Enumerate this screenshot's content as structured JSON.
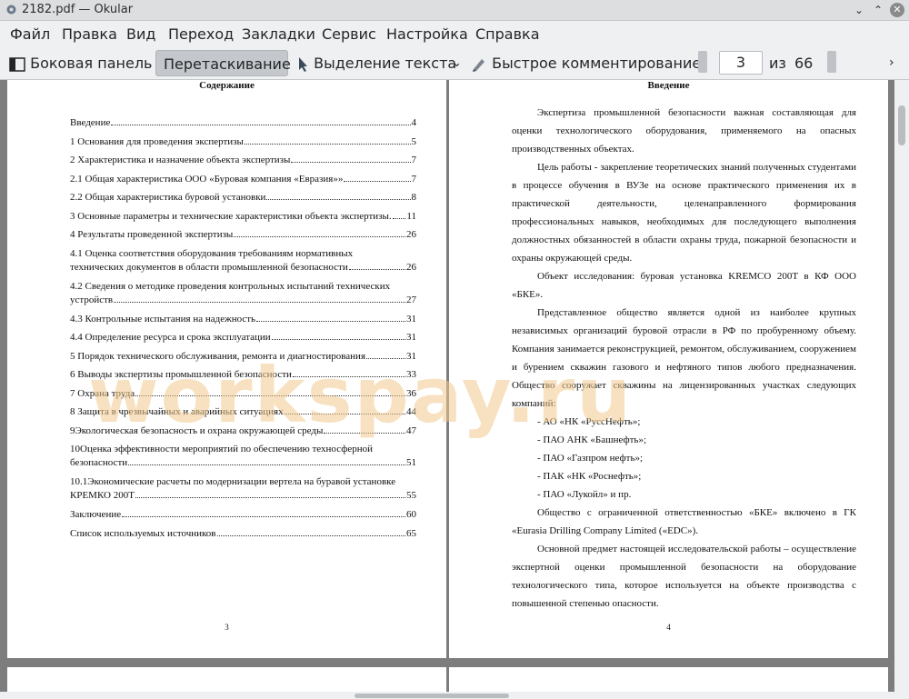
{
  "window": {
    "title": "2182.pdf  — Okular"
  },
  "menu": [
    "Файл",
    "Правка",
    "Вид",
    "Переход",
    "Закладки",
    "Сервис",
    "Настройка",
    "Справка"
  ],
  "toolbar": {
    "sidebar": "Боковая панель",
    "drag": "Перетаскивание",
    "text_select": "Выделение текста",
    "quick_annotate": "Быстрое комментирование",
    "current_page": "3",
    "of_label": "из",
    "total_pages": "66"
  },
  "page_left": {
    "heading": "Содержание",
    "toc": [
      {
        "label": "Введение",
        "page": "4"
      },
      {
        "label": "1 Основания для проведения экспертизы",
        "page": "5"
      },
      {
        "label": "2 Характеристика и назначение объекта экспертизы",
        "page": "7"
      },
      {
        "label": "2.1 Общая характеристика ООО «Буровая компания «Евразия»»",
        "page": "7"
      },
      {
        "label": "2.2 Общая характеристика буровой установки",
        "page": "8"
      },
      {
        "label": "3 Основные параметры и технические характеристики объекта экспертизы.",
        "page": "11"
      },
      {
        "label": "4 Результаты проведенной экспертизы",
        "page": "26"
      },
      {
        "label": "4.1 Оценка соответствия оборудования требованиям нормативных",
        "label2": "технических документов в области промышленной безопасности",
        "page": "26"
      },
      {
        "label": "4.2 Сведения о методике проведения контрольных испытаний технических",
        "label2": "устройств",
        "page": "27"
      },
      {
        "label": "4.3 Контрольные испытания на надежность",
        "page": "31"
      },
      {
        "label": "4.4 Определение ресурса и срока эксплуатации",
        "page": "31"
      },
      {
        "label": "5 Порядок технического обслуживания, ремонта и диагностирования",
        "page": "31"
      },
      {
        "label": "6 Выводы экспертизы промышленной безопасности",
        "page": "33"
      },
      {
        "label": "7 Охрана труда",
        "page": "36"
      },
      {
        "label": "8 Защита в чрезвычайных и аварийных ситуациях",
        "page": "44"
      },
      {
        "label": "9Экологическая безопасность и охрана окружающей среды",
        "page": "47"
      },
      {
        "label": "10Оценка эффективности мероприятий по обеспечению техносферной",
        "label2": "безопасности",
        "page": "51"
      },
      {
        "label": "10.1Экономические расчеты по модернизации вертела на буравой установке",
        "label2": "КРЕМКО 200Т",
        "page": "55"
      },
      {
        "label": "Заключение",
        "page": "60"
      },
      {
        "label": "Список используемых источников",
        "page": "65"
      }
    ],
    "page_number": "3"
  },
  "page_right": {
    "heading": "Введение",
    "paragraphs": [
      "Экспертиза промышленной безопасности важная составляющая для оценки технологического оборудования, применяемого на опасных производственных объектах.",
      "Цель работы - закрепление теоретических знаний полученных студентами в процессе обучения в ВУЗе на основе практического применения их в практической деятельности, целенаправленного формирования профессиональных навыков, необходимых для последующего выполнения должностных обязанностей в области охраны труда, пожарной безопасности и охраны окружающей среды.",
      "Объект исследования: буровая установка KREMCO 200T в КФ ООО «БКЕ».",
      "Представленное общество является одной из наиболее крупных независимых организаций буровой отрасли в РФ по пробуренному объему. Компания занимается реконструкцией, ремонтом, обслуживанием, сооружением и бурением скважин газового и нефтяного типов любого предназначения. Общество сооружает скважины на лицензированных участках следующих компаний:",
      "- АО «НК «РуссНефть»;",
      "- ПАО АНК «Башнефть»;",
      "- ПАО «Газпром нефть»;",
      "- ПАК «НК «Роснефть»;",
      "- ПАО «Лукойл» и пр.",
      "Общество с ограниченной ответственностью «БКЕ» включено в ГК «Eurasia Drilling Company Limited («EDC»).",
      "Основной предмет настоящей исследовательской работы – осуществление экспертной оценки промышленной безопасности на оборудование технологического типа, которое используется на объекте производства с повышенной степенью опасности."
    ],
    "page_number": "4"
  },
  "watermark": "workspay.ru"
}
